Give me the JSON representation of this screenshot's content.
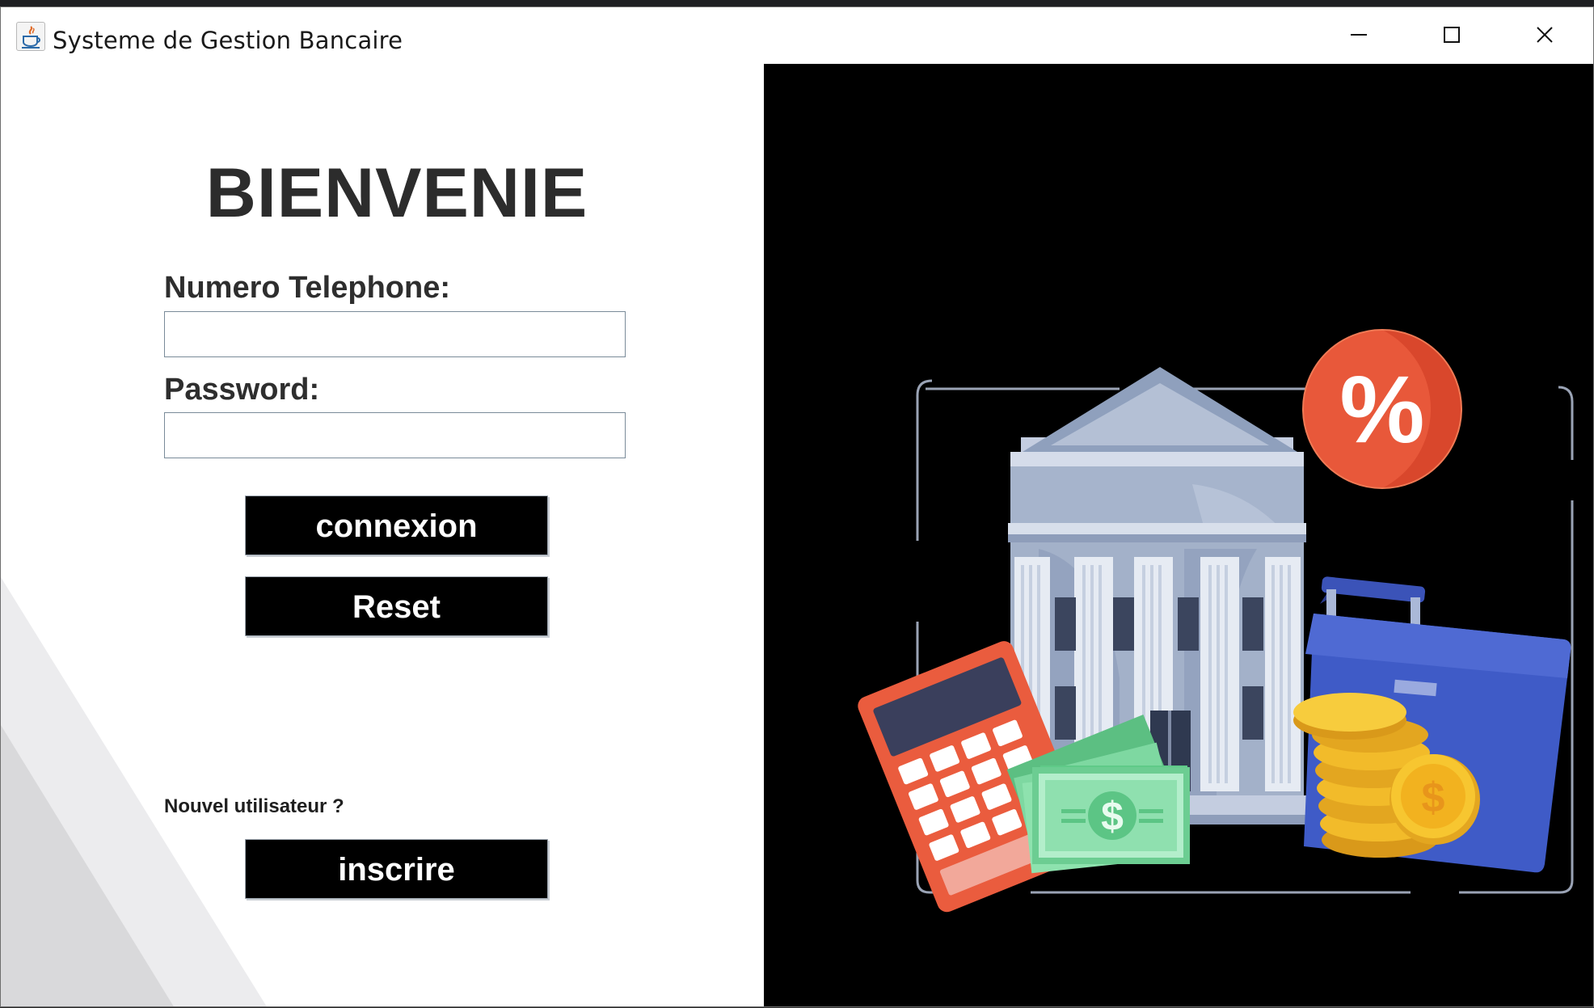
{
  "window": {
    "title": "Systeme de Gestion Bancaire",
    "controls": [
      "minimize",
      "maximize",
      "close"
    ]
  },
  "login": {
    "heading": "BIENVENIE",
    "phone_label": "Numero Telephone:",
    "phone_value": "",
    "password_label": "Password:",
    "password_value": "",
    "connect_label": "connexion",
    "reset_label": "Reset",
    "new_user_text": "Nouvel utilisateur ?",
    "signup_label": "inscrire"
  },
  "illustration": {
    "percent_badge": "%",
    "bill_symbol": "$",
    "coin_symbol": "$"
  },
  "colors": {
    "button_bg": "#000000",
    "illustration_bg": "#000000",
    "badge": "#e8583a",
    "calculator": "#ea5c3e",
    "briefcase": "#3f5bc7",
    "coins": "#f2bb2a",
    "bills": "#79d69b",
    "bank": "#a9b7cc"
  }
}
